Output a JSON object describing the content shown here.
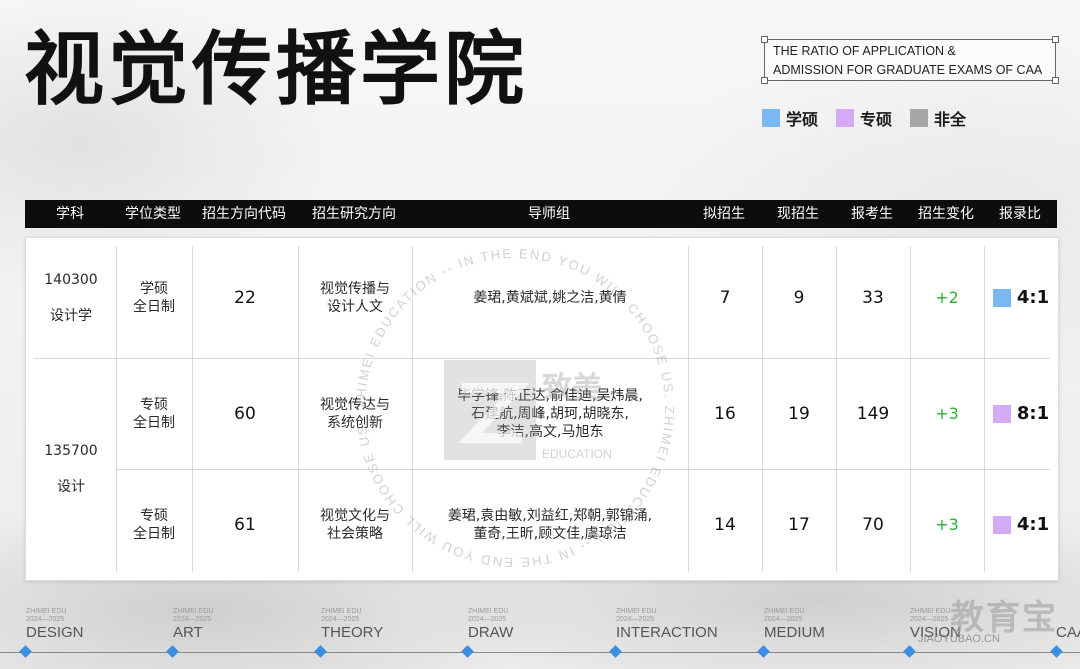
{
  "title": "视觉传播学院",
  "subtitle": {
    "line1": "THE RATIO OF APPLICATION &",
    "line2": "ADMISSION FOR GRADUATE EXAMS OF CAA"
  },
  "legend": [
    {
      "label": "学硕",
      "color": "#7bb8f2"
    },
    {
      "label": "专硕",
      "color": "#d3aaf3"
    },
    {
      "label": "非全",
      "color": "#a6a6a6"
    }
  ],
  "table": {
    "headers": [
      "学科",
      "学位类型",
      "招生方向代码",
      "招生研究方向",
      "导师组",
      "拟招生",
      "现招生",
      "报考生",
      "招生变化",
      "报录比"
    ],
    "subjects": [
      {
        "code": "140300",
        "name": "设计学"
      },
      {
        "code": "135700",
        "name": "设计"
      }
    ],
    "rows": [
      {
        "degree": "学硕\n全日制",
        "direction_code": "22",
        "direction": "视觉传播与\n设计人文",
        "advisors": "姜珺,黄斌斌,姚之洁,黄倩",
        "planned": "7",
        "current": "9",
        "applicants": "33",
        "change": "+2",
        "ratio": "4:1",
        "ratio_color": "#7bb8f2"
      },
      {
        "degree": "专硕\n全日制",
        "direction_code": "60",
        "direction": "视觉传达与\n系统创新",
        "advisors": "毕学锋,陈正达,俞佳迪,吴炜晨,\n石建航,周峰,胡珂,胡晓东,\n李洁,高文,马旭东",
        "planned": "16",
        "current": "19",
        "applicants": "149",
        "change": "+3",
        "ratio": "8:1",
        "ratio_color": "#d3aaf3"
      },
      {
        "degree": "专硕\n全日制",
        "direction_code": "61",
        "direction": "视觉文化与\n社会策略",
        "advisors": "姜珺,袁由敏,刘益红,郑朝,郭锦涌,\n董奇,王昕,顾文佳,虞琼洁",
        "planned": "14",
        "current": "17",
        "applicants": "70",
        "change": "+3",
        "ratio": "4:1",
        "ratio_color": "#d3aaf3"
      }
    ]
  },
  "watermark": {
    "ring_text": "ZHIMEI EDUCATION -- IN THE END YOU WILL CHOOSE US. ZHIMEI EDUCATION -- IN THE END YOU WILL CHOOSE US.",
    "logo_cn": "致美",
    "logo_en": "EDUCATION"
  },
  "bottom": {
    "categories": [
      "DESIGN",
      "ART",
      "THEORY",
      "DRAW",
      "INTERACTION",
      "MEDIUM",
      "VISION",
      "CAA"
    ],
    "tiny_line1": "ZHIMEI EDU",
    "tiny_line2": "2024—2025",
    "brand": "教育宝",
    "brand_url": "JIAOYUBAO.CN"
  }
}
